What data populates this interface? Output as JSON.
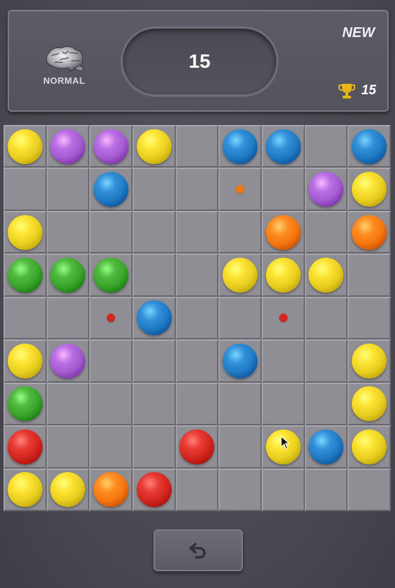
{
  "header": {
    "difficulty_label": "NORMAL",
    "difficulty_icon": "brain-icon",
    "score": "15",
    "new_label": "NEW",
    "best_icon": "trophy-icon",
    "best_score": "15"
  },
  "colors": {
    "yellow": "#e8cf1f",
    "purple": "#a45bd0",
    "blue": "#1f7bc4",
    "orange": "#f5770f",
    "green": "#3aa52a",
    "red": "#d3261f",
    "trophy": "#e7b51a"
  },
  "board": {
    "rows": 9,
    "cols": 9,
    "grid": [
      [
        "yellow",
        "purple",
        "purple",
        "yellow",
        null,
        "blue",
        "blue",
        null,
        "blue"
      ],
      [
        null,
        null,
        "blue",
        null,
        null,
        "dot:orange",
        null,
        "purple",
        "yellow"
      ],
      [
        "yellow",
        null,
        null,
        null,
        null,
        null,
        "orange",
        null,
        "orange"
      ],
      [
        "green",
        "green",
        "green",
        null,
        null,
        "yellow",
        "yellow",
        "yellow",
        null
      ],
      [
        null,
        null,
        "dot:red",
        "blue",
        null,
        null,
        "dot:red",
        null,
        null
      ],
      [
        "yellow",
        "purple",
        null,
        null,
        null,
        "blue",
        null,
        null,
        "yellow"
      ],
      [
        "green",
        null,
        null,
        null,
        null,
        null,
        null,
        null,
        "yellow"
      ],
      [
        "red",
        null,
        null,
        null,
        "red",
        null,
        "yellow",
        "blue",
        "yellow"
      ],
      [
        "yellow",
        "yellow",
        "orange",
        "red",
        null,
        null,
        null,
        null,
        null
      ]
    ]
  },
  "controls": {
    "undo_icon": "undo-icon",
    "cursor_icon": "mouse-cursor-icon"
  }
}
